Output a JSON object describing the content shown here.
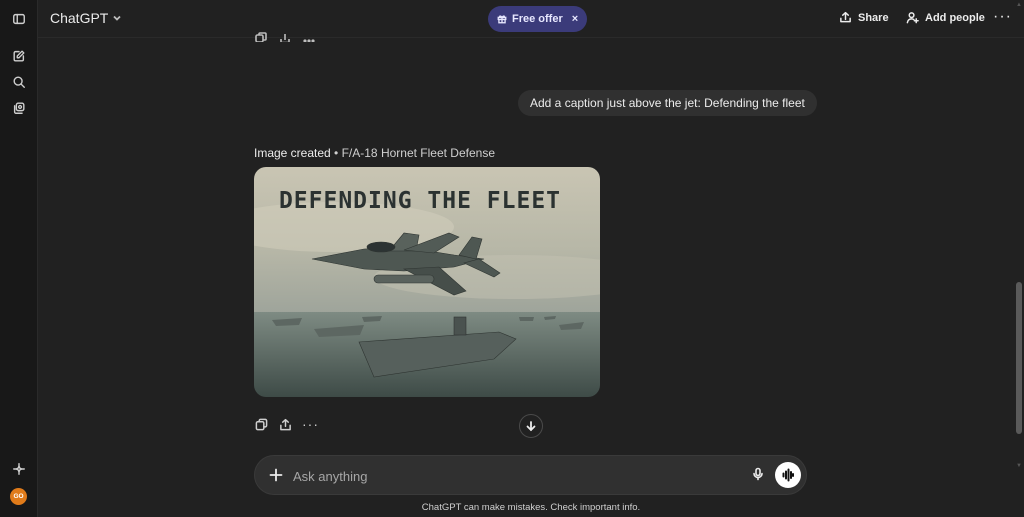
{
  "header": {
    "model_name": "ChatGPT",
    "offer_label": "Free offer",
    "offer_close": "×",
    "share_label": "Share",
    "add_people_label": "Add people",
    "more_label": "···"
  },
  "conversation": {
    "user_message": "Add a caption just above the jet: Defending the fleet",
    "image_status": "Image created",
    "image_separator": " • ",
    "image_title": "F/A-18 Hornet Fleet Defense",
    "image_caption": "DEFENDING THE FLEET",
    "more_actions": "···"
  },
  "composer": {
    "placeholder": "Ask anything"
  },
  "footer": {
    "disclaimer": "ChatGPT can make mistakes. Check important info."
  },
  "sidebar": {
    "avatar_initials": "GO"
  },
  "colors": {
    "background": "#212121",
    "rail": "#181818",
    "bubble": "#303030",
    "offer": "#3b3b7a",
    "avatar": "#e07b1a"
  }
}
